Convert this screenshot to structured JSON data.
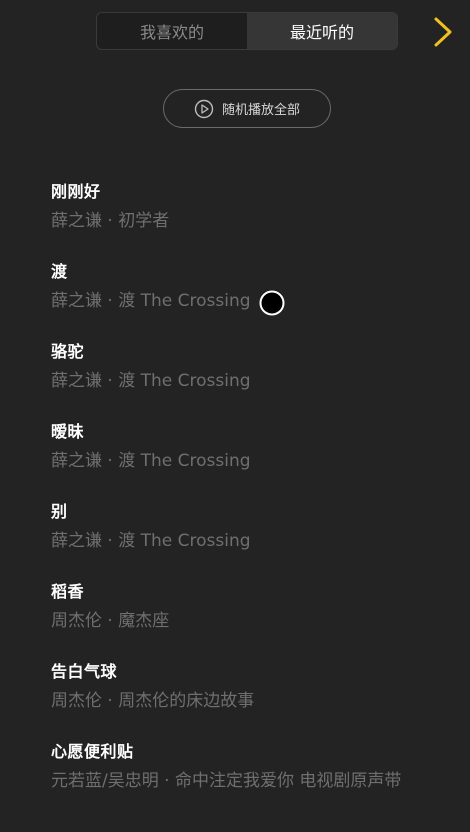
{
  "tabs": [
    {
      "label": "我喜欢的",
      "active": false
    },
    {
      "label": "最近听的",
      "active": true
    }
  ],
  "next_icon": "chevron-right-icon",
  "accent_color": "#f0c020",
  "shuffle": {
    "label": "随机播放全部",
    "icon": "play-circle-icon"
  },
  "songs": [
    {
      "title": "刚刚好",
      "meta": "薛之谦 · 初学者"
    },
    {
      "title": "渡",
      "meta": "薛之谦 · 渡 The Crossing"
    },
    {
      "title": "骆驼",
      "meta": "薛之谦 · 渡 The Crossing"
    },
    {
      "title": "暧昧",
      "meta": "薛之谦 · 渡 The Crossing"
    },
    {
      "title": "别",
      "meta": "薛之谦 · 渡 The Crossing"
    },
    {
      "title": "稻香",
      "meta": "周杰伦 · 魔杰座"
    },
    {
      "title": "告白气球",
      "meta": "周杰伦 · 周杰伦的床边故事"
    },
    {
      "title": "心愿便利贴",
      "meta": "元若蓝/吴忠明 · 命中注定我爱你 电视剧原声带"
    }
  ]
}
